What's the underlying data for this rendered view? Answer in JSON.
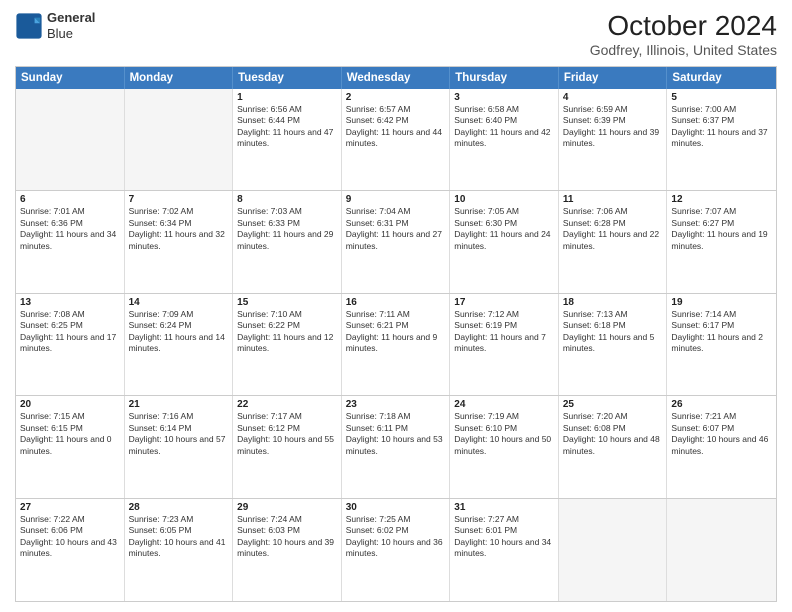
{
  "header": {
    "logo_line1": "General",
    "logo_line2": "Blue",
    "title": "October 2024",
    "subtitle": "Godfrey, Illinois, United States"
  },
  "days": [
    "Sunday",
    "Monday",
    "Tuesday",
    "Wednesday",
    "Thursday",
    "Friday",
    "Saturday"
  ],
  "rows": [
    [
      {
        "date": "",
        "info": "",
        "empty": true
      },
      {
        "date": "",
        "info": "",
        "empty": true
      },
      {
        "date": "1",
        "info": "Sunrise: 6:56 AM\nSunset: 6:44 PM\nDaylight: 11 hours and 47 minutes."
      },
      {
        "date": "2",
        "info": "Sunrise: 6:57 AM\nSunset: 6:42 PM\nDaylight: 11 hours and 44 minutes."
      },
      {
        "date": "3",
        "info": "Sunrise: 6:58 AM\nSunset: 6:40 PM\nDaylight: 11 hours and 42 minutes."
      },
      {
        "date": "4",
        "info": "Sunrise: 6:59 AM\nSunset: 6:39 PM\nDaylight: 11 hours and 39 minutes."
      },
      {
        "date": "5",
        "info": "Sunrise: 7:00 AM\nSunset: 6:37 PM\nDaylight: 11 hours and 37 minutes."
      }
    ],
    [
      {
        "date": "6",
        "info": "Sunrise: 7:01 AM\nSunset: 6:36 PM\nDaylight: 11 hours and 34 minutes."
      },
      {
        "date": "7",
        "info": "Sunrise: 7:02 AM\nSunset: 6:34 PM\nDaylight: 11 hours and 32 minutes."
      },
      {
        "date": "8",
        "info": "Sunrise: 7:03 AM\nSunset: 6:33 PM\nDaylight: 11 hours and 29 minutes."
      },
      {
        "date": "9",
        "info": "Sunrise: 7:04 AM\nSunset: 6:31 PM\nDaylight: 11 hours and 27 minutes."
      },
      {
        "date": "10",
        "info": "Sunrise: 7:05 AM\nSunset: 6:30 PM\nDaylight: 11 hours and 24 minutes."
      },
      {
        "date": "11",
        "info": "Sunrise: 7:06 AM\nSunset: 6:28 PM\nDaylight: 11 hours and 22 minutes."
      },
      {
        "date": "12",
        "info": "Sunrise: 7:07 AM\nSunset: 6:27 PM\nDaylight: 11 hours and 19 minutes."
      }
    ],
    [
      {
        "date": "13",
        "info": "Sunrise: 7:08 AM\nSunset: 6:25 PM\nDaylight: 11 hours and 17 minutes."
      },
      {
        "date": "14",
        "info": "Sunrise: 7:09 AM\nSunset: 6:24 PM\nDaylight: 11 hours and 14 minutes."
      },
      {
        "date": "15",
        "info": "Sunrise: 7:10 AM\nSunset: 6:22 PM\nDaylight: 11 hours and 12 minutes."
      },
      {
        "date": "16",
        "info": "Sunrise: 7:11 AM\nSunset: 6:21 PM\nDaylight: 11 hours and 9 minutes."
      },
      {
        "date": "17",
        "info": "Sunrise: 7:12 AM\nSunset: 6:19 PM\nDaylight: 11 hours and 7 minutes."
      },
      {
        "date": "18",
        "info": "Sunrise: 7:13 AM\nSunset: 6:18 PM\nDaylight: 11 hours and 5 minutes."
      },
      {
        "date": "19",
        "info": "Sunrise: 7:14 AM\nSunset: 6:17 PM\nDaylight: 11 hours and 2 minutes."
      }
    ],
    [
      {
        "date": "20",
        "info": "Sunrise: 7:15 AM\nSunset: 6:15 PM\nDaylight: 11 hours and 0 minutes."
      },
      {
        "date": "21",
        "info": "Sunrise: 7:16 AM\nSunset: 6:14 PM\nDaylight: 10 hours and 57 minutes."
      },
      {
        "date": "22",
        "info": "Sunrise: 7:17 AM\nSunset: 6:12 PM\nDaylight: 10 hours and 55 minutes."
      },
      {
        "date": "23",
        "info": "Sunrise: 7:18 AM\nSunset: 6:11 PM\nDaylight: 10 hours and 53 minutes."
      },
      {
        "date": "24",
        "info": "Sunrise: 7:19 AM\nSunset: 6:10 PM\nDaylight: 10 hours and 50 minutes."
      },
      {
        "date": "25",
        "info": "Sunrise: 7:20 AM\nSunset: 6:08 PM\nDaylight: 10 hours and 48 minutes."
      },
      {
        "date": "26",
        "info": "Sunrise: 7:21 AM\nSunset: 6:07 PM\nDaylight: 10 hours and 46 minutes."
      }
    ],
    [
      {
        "date": "27",
        "info": "Sunrise: 7:22 AM\nSunset: 6:06 PM\nDaylight: 10 hours and 43 minutes."
      },
      {
        "date": "28",
        "info": "Sunrise: 7:23 AM\nSunset: 6:05 PM\nDaylight: 10 hours and 41 minutes."
      },
      {
        "date": "29",
        "info": "Sunrise: 7:24 AM\nSunset: 6:03 PM\nDaylight: 10 hours and 39 minutes."
      },
      {
        "date": "30",
        "info": "Sunrise: 7:25 AM\nSunset: 6:02 PM\nDaylight: 10 hours and 36 minutes."
      },
      {
        "date": "31",
        "info": "Sunrise: 7:27 AM\nSunset: 6:01 PM\nDaylight: 10 hours and 34 minutes."
      },
      {
        "date": "",
        "info": "",
        "empty": true
      },
      {
        "date": "",
        "info": "",
        "empty": true
      }
    ]
  ]
}
